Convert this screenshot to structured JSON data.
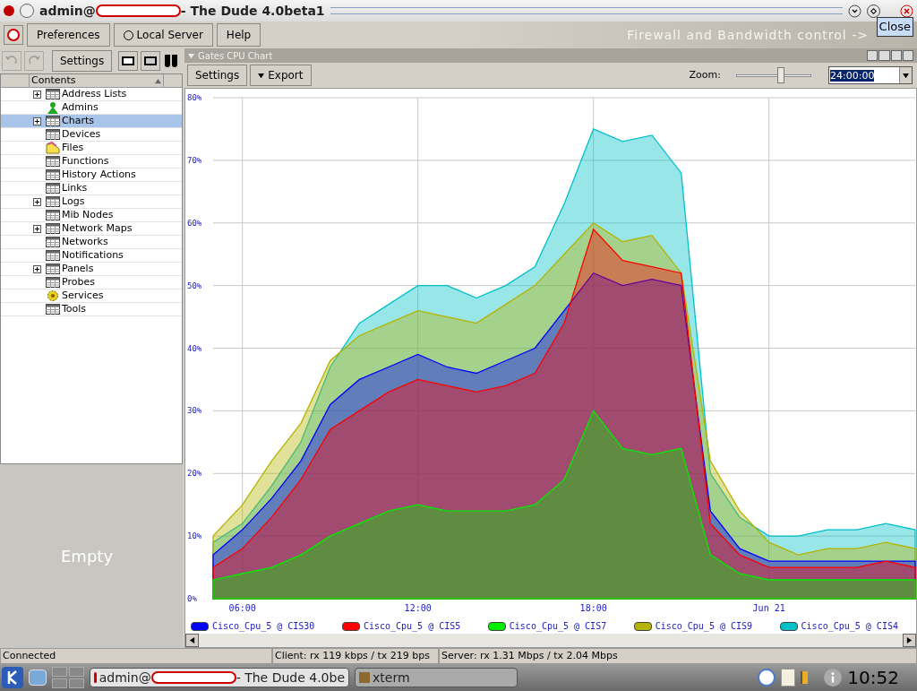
{
  "window": {
    "title_prefix": "admin@",
    "title_suffix": "- The Dude 4.0beta1",
    "tooltip": "Close"
  },
  "menu": [
    {
      "label": "Preferences",
      "kind": "plain"
    },
    {
      "label": "Local Server",
      "kind": "radio"
    },
    {
      "label": "Help",
      "kind": "plain"
    }
  ],
  "banner": "Firewall and Bandwidth control ->",
  "left_toolbar": {
    "settings": "Settings"
  },
  "tree": {
    "header": "Contents",
    "items": [
      {
        "label": "Address Lists",
        "kind": "table",
        "expandable": true,
        "selected": false
      },
      {
        "label": "Admins",
        "kind": "admin",
        "expandable": false,
        "selected": false
      },
      {
        "label": "Charts",
        "kind": "table",
        "expandable": true,
        "selected": true
      },
      {
        "label": "Devices",
        "kind": "table",
        "expandable": false,
        "selected": false
      },
      {
        "label": "Files",
        "kind": "files",
        "expandable": false,
        "selected": false
      },
      {
        "label": "Functions",
        "kind": "table",
        "expandable": false,
        "selected": false
      },
      {
        "label": "History Actions",
        "kind": "table",
        "expandable": false,
        "selected": false
      },
      {
        "label": "Links",
        "kind": "table",
        "expandable": false,
        "selected": false
      },
      {
        "label": "Logs",
        "kind": "table",
        "expandable": true,
        "selected": false
      },
      {
        "label": "Mib Nodes",
        "kind": "table",
        "expandable": false,
        "selected": false
      },
      {
        "label": "Network Maps",
        "kind": "table",
        "expandable": true,
        "selected": false
      },
      {
        "label": "Networks",
        "kind": "table",
        "expandable": false,
        "selected": false
      },
      {
        "label": "Notifications",
        "kind": "table",
        "expandable": false,
        "selected": false
      },
      {
        "label": "Panels",
        "kind": "table",
        "expandable": true,
        "selected": false
      },
      {
        "label": "Probes",
        "kind": "table",
        "expandable": false,
        "selected": false
      },
      {
        "label": "Services",
        "kind": "services",
        "expandable": false,
        "selected": false
      },
      {
        "label": "Tools",
        "kind": "table",
        "expandable": false,
        "selected": false
      }
    ]
  },
  "empty_panel": "Empty",
  "chart_panel": {
    "title": "Gates CPU Chart",
    "settings": "Settings",
    "export": "Export",
    "zoom_label": "Zoom:",
    "zoom": {
      "level": 0.6
    },
    "period": "24:00:00",
    "chart_data": {
      "type": "area",
      "x": [
        5,
        6,
        7,
        8,
        9,
        10,
        11,
        12,
        13,
        14,
        15,
        16,
        17,
        18,
        19,
        20,
        21,
        22,
        23,
        24,
        25,
        26,
        27,
        28,
        29
      ],
      "xlim": [
        5,
        29
      ],
      "ylim": [
        0,
        80
      ],
      "xticks": [
        {
          "value": 6,
          "label": "06:00"
        },
        {
          "value": 12,
          "label": "12:00"
        },
        {
          "value": 18,
          "label": "18:00"
        },
        {
          "value": 24,
          "label": "Jun 21"
        }
      ],
      "yticks": [
        {
          "value": 0,
          "label": "0%"
        },
        {
          "value": 10,
          "label": "10%"
        },
        {
          "value": 20,
          "label": "20%"
        },
        {
          "value": 30,
          "label": "30%"
        },
        {
          "value": 40,
          "label": "40%"
        },
        {
          "value": 50,
          "label": "50%"
        },
        {
          "value": 60,
          "label": "60%"
        },
        {
          "value": 70,
          "label": "70%"
        },
        {
          "value": 80,
          "label": "80%"
        }
      ],
      "stacked": false,
      "grid": true,
      "legend": true,
      "series": [
        {
          "name": "Cisco_Cpu_5 @ CIS30",
          "color": "#0000ff",
          "values": [
            7,
            11,
            16,
            22,
            31,
            35,
            37,
            39,
            37,
            36,
            38,
            40,
            46,
            52,
            50,
            51,
            50,
            14,
            8,
            6,
            6,
            6,
            6,
            6,
            6
          ]
        },
        {
          "name": "Cisco_Cpu_5 @ CIS5",
          "color": "#ff0000",
          "values": [
            5,
            8,
            13,
            19,
            27,
            30,
            33,
            35,
            34,
            33,
            34,
            36,
            44,
            59,
            54,
            53,
            52,
            12,
            7,
            5,
            5,
            5,
            5,
            6,
            5
          ]
        },
        {
          "name": "Cisco_Cpu_5 @ CIS7",
          "color": "#00ee00",
          "values": [
            3,
            4,
            5,
            7,
            10,
            12,
            14,
            15,
            14,
            14,
            14,
            15,
            19,
            30,
            24,
            23,
            24,
            7,
            4,
            3,
            3,
            3,
            3,
            3,
            3
          ]
        },
        {
          "name": "Cisco_Cpu_5 @ CIS9",
          "color": "#b4b400",
          "values": [
            10,
            15,
            22,
            28,
            38,
            42,
            44,
            46,
            45,
            44,
            47,
            50,
            55,
            60,
            57,
            58,
            52,
            22,
            14,
            9,
            7,
            8,
            8,
            9,
            8
          ]
        },
        {
          "name": "Cisco_Cpu_5 @ CIS4",
          "color": "#00c0c8",
          "values": [
            9,
            12,
            18,
            25,
            37,
            44,
            47,
            50,
            50,
            48,
            50,
            53,
            63,
            75,
            73,
            74,
            68,
            20,
            13,
            10,
            10,
            11,
            11,
            12,
            11
          ]
        }
      ]
    }
  },
  "status_bar": [
    "Connected",
    "Client: rx 119 kbps / tx 219 bps",
    "Server: rx 1.31 Mbps / tx 2.04 Mbps"
  ],
  "taskbar": {
    "tasks": [
      {
        "prefix": "admin@",
        "suffix": "- The Dude 4.0be",
        "selected": true
      },
      {
        "prefix": "xterm",
        "selected": false
      }
    ],
    "clock": "10:52"
  }
}
